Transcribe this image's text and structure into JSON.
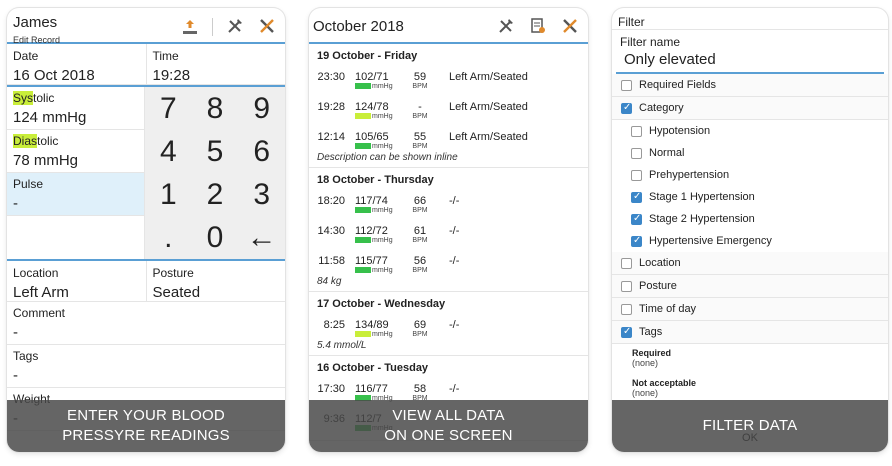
{
  "colors": {
    "accent": "#5a9fd4",
    "green_bar": "#37c04b",
    "yellow_bar": "#c9ee3a",
    "checkbox": "#3b86c8",
    "caption_bg": "#484848"
  },
  "panel1": {
    "name": "James",
    "subtitle": "Edit Record",
    "icons": [
      "share-icon",
      "tools-icon",
      "tools-x-icon"
    ],
    "date_label": "Date",
    "date_value": "16 Oct 2018",
    "time_label": "Time",
    "time_value": "19:28",
    "systolic_hl": "Sys",
    "systolic_rest": "tolic",
    "systolic_value": "124 mmHg",
    "diastolic_hl": "Dias",
    "diastolic_rest": "tolic",
    "diastolic_value": "78 mmHg",
    "pulse_label": "Pulse",
    "pulse_value": "-",
    "keys": [
      "7",
      "8",
      "9",
      "4",
      "5",
      "6",
      "1",
      "2",
      "3",
      ".",
      "0",
      "←"
    ],
    "location_label": "Location",
    "location_value": "Left Arm",
    "posture_label": "Posture",
    "posture_value": "Seated",
    "comment_label": "Comment",
    "comment_value": "-",
    "tags_label": "Tags",
    "tags_value": "-",
    "weight_label": "Weight",
    "weight_value": "-",
    "caption": "ENTER YOUR BLOOD\nPRESSYRE READINGS"
  },
  "panel2": {
    "title": "October 2018",
    "units_bp": "mmHg",
    "units_pulse": "BPM",
    "days": [
      {
        "header": "19 October - Friday",
        "readings": [
          {
            "time": "23:30",
            "bp": "102/71",
            "pulse": "59",
            "loc": "Left Arm/Seated",
            "bar": "green"
          },
          {
            "time": "19:28",
            "bp": "124/78",
            "pulse": "-",
            "loc": "Left Arm/Seated",
            "bar": "yellow"
          },
          {
            "time": "12:14",
            "bp": "105/65",
            "pulse": "55",
            "loc": "Left Arm/Seated",
            "bar": "green"
          }
        ],
        "note": "Description can be shown inline"
      },
      {
        "header": "18 October - Thursday",
        "readings": [
          {
            "time": "18:20",
            "bp": "117/74",
            "pulse": "66",
            "loc": "-/-",
            "bar": "green"
          },
          {
            "time": "14:30",
            "bp": "112/72",
            "pulse": "61",
            "loc": "-/-",
            "bar": "green"
          },
          {
            "time": "11:58",
            "bp": "115/77",
            "pulse": "56",
            "loc": "-/-",
            "bar": "green"
          }
        ],
        "note": "84 kg"
      },
      {
        "header": "17 October - Wednesday",
        "readings": [
          {
            "time": "8:25",
            "bp": "134/89",
            "pulse": "69",
            "loc": "-/-",
            "bar": "yellow"
          }
        ],
        "note": "5.4 mmol/L"
      },
      {
        "header": "16 October - Tuesday",
        "readings": [
          {
            "time": "17:30",
            "bp": "116/77",
            "pulse": "58",
            "loc": "-/-",
            "bar": "green"
          },
          {
            "time": "9:36",
            "bp": "112/7",
            "pulse": "",
            "loc": "",
            "bar": "green"
          }
        ],
        "note": ""
      }
    ],
    "caption": "VIEW ALL DATA\nON ONE SCREEN"
  },
  "panel3": {
    "title": "Filter",
    "filter_name_label": "Filter name",
    "filter_name_value": "Only elevated",
    "required_fields": "Required Fields",
    "category": "Category",
    "categories": [
      {
        "label": "Hypotension",
        "checked": false
      },
      {
        "label": "Normal",
        "checked": false
      },
      {
        "label": "Prehypertension",
        "checked": false
      },
      {
        "label": "Stage 1 Hypertension",
        "checked": true
      },
      {
        "label": "Stage 2 Hypertension",
        "checked": true
      },
      {
        "label": "Hypertensive Emergency",
        "checked": true
      }
    ],
    "location": "Location",
    "posture": "Posture",
    "time_of_day": "Time of day",
    "tags": "Tags",
    "required_label": "Required",
    "required_value": "(none)",
    "not_acceptable_label": "Not acceptable",
    "not_acceptable_value": "(none)",
    "ok": "OK",
    "caption": "FILTER DATA"
  }
}
